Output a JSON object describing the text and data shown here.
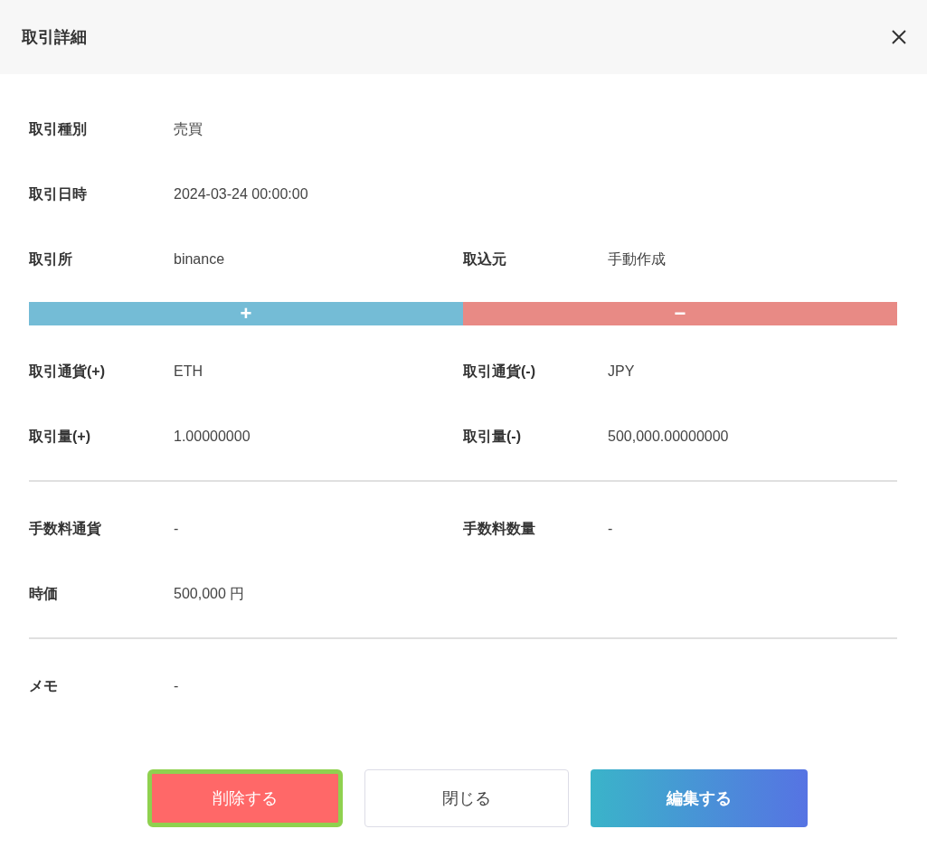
{
  "dialog": {
    "title": "取引詳細"
  },
  "body": [
    {
      "kind": "row",
      "cells": [
        {
          "label": "取引種別",
          "value": "売買"
        }
      ]
    },
    {
      "kind": "row",
      "cells": [
        {
          "label": "取引日時",
          "value": "2024-03-24 00:00:00"
        }
      ]
    },
    {
      "kind": "row",
      "cells": [
        {
          "label": "取引所",
          "value": "binance"
        },
        {
          "label": "取込元",
          "value": "手動作成"
        }
      ]
    },
    {
      "kind": "sides",
      "sides": [
        {
          "glyph": "+",
          "color": "#74bcd6"
        },
        {
          "glyph": "−",
          "color": "#e88a85"
        }
      ]
    },
    {
      "kind": "row",
      "cells": [
        {
          "label": "取引通貨(+)",
          "value": "ETH"
        },
        {
          "label": "取引通貨(-)",
          "value": "JPY"
        }
      ]
    },
    {
      "kind": "row",
      "cells": [
        {
          "label": "取引量(+)",
          "value": "1.00000000"
        },
        {
          "label": "取引量(-)",
          "value": "500,000.00000000"
        }
      ]
    },
    {
      "kind": "divider"
    },
    {
      "kind": "row",
      "cells": [
        {
          "label": "手数料通貨",
          "value": "-"
        },
        {
          "label": "手数料数量",
          "value": "-"
        }
      ]
    },
    {
      "kind": "row",
      "cells": [
        {
          "label": "時価",
          "value": "500,000 円"
        }
      ]
    },
    {
      "kind": "divider"
    },
    {
      "kind": "row",
      "cells": [
        {
          "label": "メモ",
          "value": "-"
        }
      ]
    }
  ],
  "buttons": [
    {
      "kind": "danger",
      "label": "削除する",
      "focused": true
    },
    {
      "kind": "plain",
      "label": "閉じる",
      "focused": false
    },
    {
      "kind": "primary",
      "label": "編集する",
      "focused": false
    }
  ]
}
